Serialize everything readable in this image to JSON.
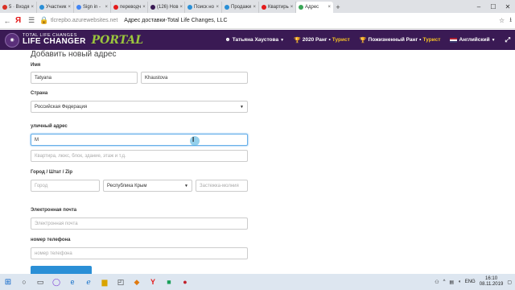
{
  "browser": {
    "tabs": [
      {
        "label": "5 · Входя",
        "color": "#d93025",
        "active": false
      },
      {
        "label": "Участник",
        "color": "#2a8fd6",
        "active": false
      },
      {
        "label": "Sign in -",
        "color": "#4285f4",
        "active": false
      },
      {
        "label": "переводч",
        "color": "#e41b1b",
        "active": false
      },
      {
        "label": "(126) Нов",
        "color": "#3a1a54",
        "active": false
      },
      {
        "label": "Поиск но",
        "color": "#2a8fd6",
        "active": false
      },
      {
        "label": "Продажи",
        "color": "#2a8fd6",
        "active": false
      },
      {
        "label": "Квартирь",
        "color": "#e41b1b",
        "active": false
      },
      {
        "label": "Адрес",
        "color": "#3aa657",
        "active": true
      }
    ],
    "url": "tlcrepbo.azurewebsites.net",
    "page_title": "Адрес доставки-Total Life Changes, LLC"
  },
  "header": {
    "logo_top": "TOTAL LIFE CHANGES",
    "logo_main": "LIFE CHANGER",
    "logo_portal": "PORTAL",
    "user_name": "Татьяна Хаустова",
    "rank_prefix": "2020 Ранг",
    "rank_value": "Турист",
    "lifetime_prefix": "Пожизненный Ранг",
    "lifetime_value": "Турист",
    "language": "Английский"
  },
  "form": {
    "title": "Добавить новый адрес",
    "name_label": "Имя",
    "first_name": "Tatyana",
    "last_name": "Khaustova",
    "country_label": "Страна",
    "country_value": "Российская Федерация",
    "street_label": "уличный адрес",
    "street_value": "М",
    "street2_placeholder": "Квартира, люкс, блок, здание, этаж и т.д.",
    "city_label": "Город / Штат / Zip",
    "city_placeholder": "Город",
    "state_value": "Республика Крым",
    "zip_placeholder": "Застежка-молния",
    "email_label": "Электронная почта",
    "email_placeholder": "Электронная почта",
    "phone_label": "номер телефона",
    "phone_placeholder": "номер телефона"
  },
  "taskbar": {
    "language": "ENG",
    "time": "16:10",
    "date": "08.11.2019"
  }
}
